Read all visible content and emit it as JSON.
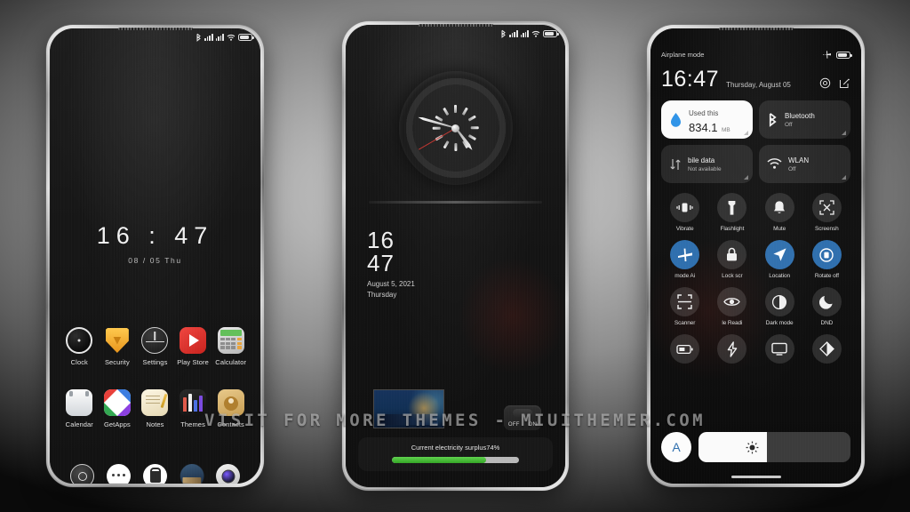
{
  "watermark": "VISIT FOR MORE THEMES - MIUITHEMER.COM",
  "statusbar": {
    "icons": [
      "bluetooth-icon",
      "signal-1-icon",
      "signal-2-icon",
      "wifi-icon",
      "battery-icon"
    ]
  },
  "phone1": {
    "clock": {
      "time": "16 : 47",
      "date": "08 / 05  Thu"
    },
    "apps_row1": [
      {
        "label": "Clock",
        "icon": "clock-icon"
      },
      {
        "label": "Security",
        "icon": "security-shield-icon"
      },
      {
        "label": "Settings",
        "icon": "settings-icon"
      },
      {
        "label": "Play Store",
        "icon": "play-store-icon"
      },
      {
        "label": "Calculator",
        "icon": "calculator-icon"
      }
    ],
    "apps_row2": [
      {
        "label": "Calendar",
        "icon": "calendar-icon"
      },
      {
        "label": "GetApps",
        "icon": "getapps-icon"
      },
      {
        "label": "Notes",
        "icon": "notes-icon"
      },
      {
        "label": "Themes",
        "icon": "themes-icon"
      },
      {
        "label": "Contacts",
        "icon": "contacts-icon"
      }
    ],
    "dock": [
      {
        "icon": "dialer-icon"
      },
      {
        "icon": "messages-icon"
      },
      {
        "icon": "lock-security-icon"
      },
      {
        "icon": "gallery-icon"
      },
      {
        "icon": "camera-icon"
      }
    ]
  },
  "phone2": {
    "watch": {
      "icon": "analog-watch-icon",
      "hour": 16,
      "minute": 47,
      "second": 40
    },
    "time": {
      "hour": "16",
      "minute": "47",
      "date": "August 5, 2021",
      "weekday": "Thursday"
    },
    "photo_widget": {
      "name": "photo-widget"
    },
    "toggle_widget": {
      "off_label": "OFF",
      "on_label": "ON"
    },
    "battery_widget": {
      "caption": "Current electricity surplus74%",
      "percent": 74
    }
  },
  "phone3": {
    "airplane_label": "Airplane mode",
    "header_icons": [
      "airplane-icon",
      "battery-icon"
    ],
    "clock": {
      "time": "16:47",
      "date": "Thursday, August 05"
    },
    "actions": [
      "settings-gear-icon",
      "edit-icon"
    ],
    "tiles": [
      {
        "name": "data-usage",
        "title": "Used this",
        "value": "834.1",
        "unit": "MB",
        "icon": "data-drop-icon",
        "active": true
      },
      {
        "name": "bluetooth",
        "title": "Bluetooth",
        "sub": "Off",
        "icon": "bluetooth-icon",
        "active": false
      },
      {
        "name": "mobile-data",
        "title": "bile data",
        "sub": "Not available",
        "icon": "mobile-data-icon",
        "active": false
      },
      {
        "name": "wlan",
        "title": "WLAN",
        "sub": "Off",
        "icon": "wifi-icon",
        "active": false
      }
    ],
    "quick_toggles": [
      {
        "label": "Vibrate",
        "icon": "vibrate-icon",
        "on": false
      },
      {
        "label": "Flashlight",
        "icon": "flashlight-icon",
        "on": false
      },
      {
        "label": "Mute",
        "icon": "bell-mute-icon",
        "on": false
      },
      {
        "label": "Screensh",
        "icon": "screenshot-icon",
        "on": false
      },
      {
        "label": "mode    Ai",
        "icon": "airplane-icon",
        "on": true
      },
      {
        "label": "Lock scr",
        "icon": "lock-icon",
        "on": false
      },
      {
        "label": "Location",
        "icon": "location-icon",
        "on": true
      },
      {
        "label": "Rotate off",
        "icon": "rotate-icon",
        "on": true
      },
      {
        "label": "Scanner",
        "icon": "scanner-icon",
        "on": false
      },
      {
        "label": "le   Readi",
        "icon": "eye-reading-icon",
        "on": false
      },
      {
        "label": "Dark mode",
        "icon": "contrast-icon",
        "on": false
      },
      {
        "label": "DND",
        "icon": "moon-icon",
        "on": false
      },
      {
        "label": "",
        "icon": "battery-saver-icon",
        "on": false
      },
      {
        "label": "",
        "icon": "boost-icon",
        "on": false
      },
      {
        "label": "",
        "icon": "cast-screen-icon",
        "on": false
      },
      {
        "label": "",
        "icon": "color-theme-icon",
        "on": false
      }
    ],
    "brightness": {
      "auto_label": "A",
      "icon": "sun-icon",
      "percent": 45
    }
  }
}
